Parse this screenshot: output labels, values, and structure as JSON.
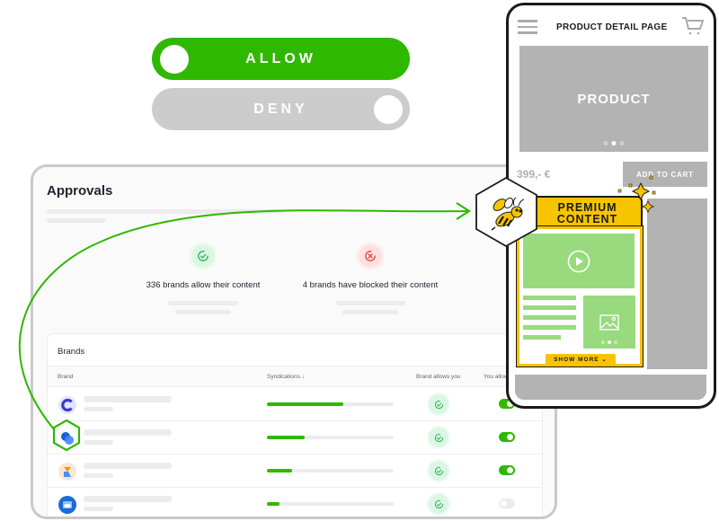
{
  "toggles": {
    "allow_label": "ALLOW",
    "allow_state": "on",
    "deny_label": "DENY",
    "deny_state": "off",
    "accent": "#2fb800",
    "inactive": "#cccccc"
  },
  "approvals": {
    "title": "Approvals",
    "stats": [
      {
        "text": "336 brands allow their content",
        "icon": "check-circle-icon",
        "tone": "success"
      },
      {
        "text": "4 brands have blocked their content",
        "icon": "x-circle-icon",
        "tone": "danger"
      }
    ],
    "brands": {
      "title": "Brands",
      "columns": [
        "Brand",
        "Syndications",
        "Brand allows you",
        "You allow"
      ],
      "sort_column": "Syndications",
      "sort_direction": "descending",
      "rows": [
        {
          "logo": "brand-logo-c",
          "syndication_fraction": 0.6,
          "brand_allows_you": true,
          "you_allow": true
        },
        {
          "logo": "brand-logo-circles",
          "syndication_fraction": 0.3,
          "brand_allows_you": true,
          "you_allow": true,
          "highlighted": true
        },
        {
          "logo": "brand-logo-r",
          "syndication_fraction": 0.2,
          "brand_allows_you": true,
          "you_allow": true
        },
        {
          "logo": "brand-logo-blue-box",
          "syndication_fraction": 0.1,
          "brand_allows_you": true,
          "you_allow": false
        }
      ]
    }
  },
  "phone": {
    "page_title": "PRODUCT DETAIL PAGE",
    "hero_label": "PRODUCT",
    "hero_carousel": {
      "count": 3,
      "active": 2
    },
    "price": "399,- €",
    "add_to_cart": "ADD TO CART",
    "premium": {
      "label_line1": "PREMIUM",
      "label_line2": "CONTENT",
      "show_more": "SHOW MORE",
      "image_carousel": {
        "count": 3,
        "active": 2
      },
      "accent": "#f7c400",
      "content_color": "#98da7d"
    }
  }
}
